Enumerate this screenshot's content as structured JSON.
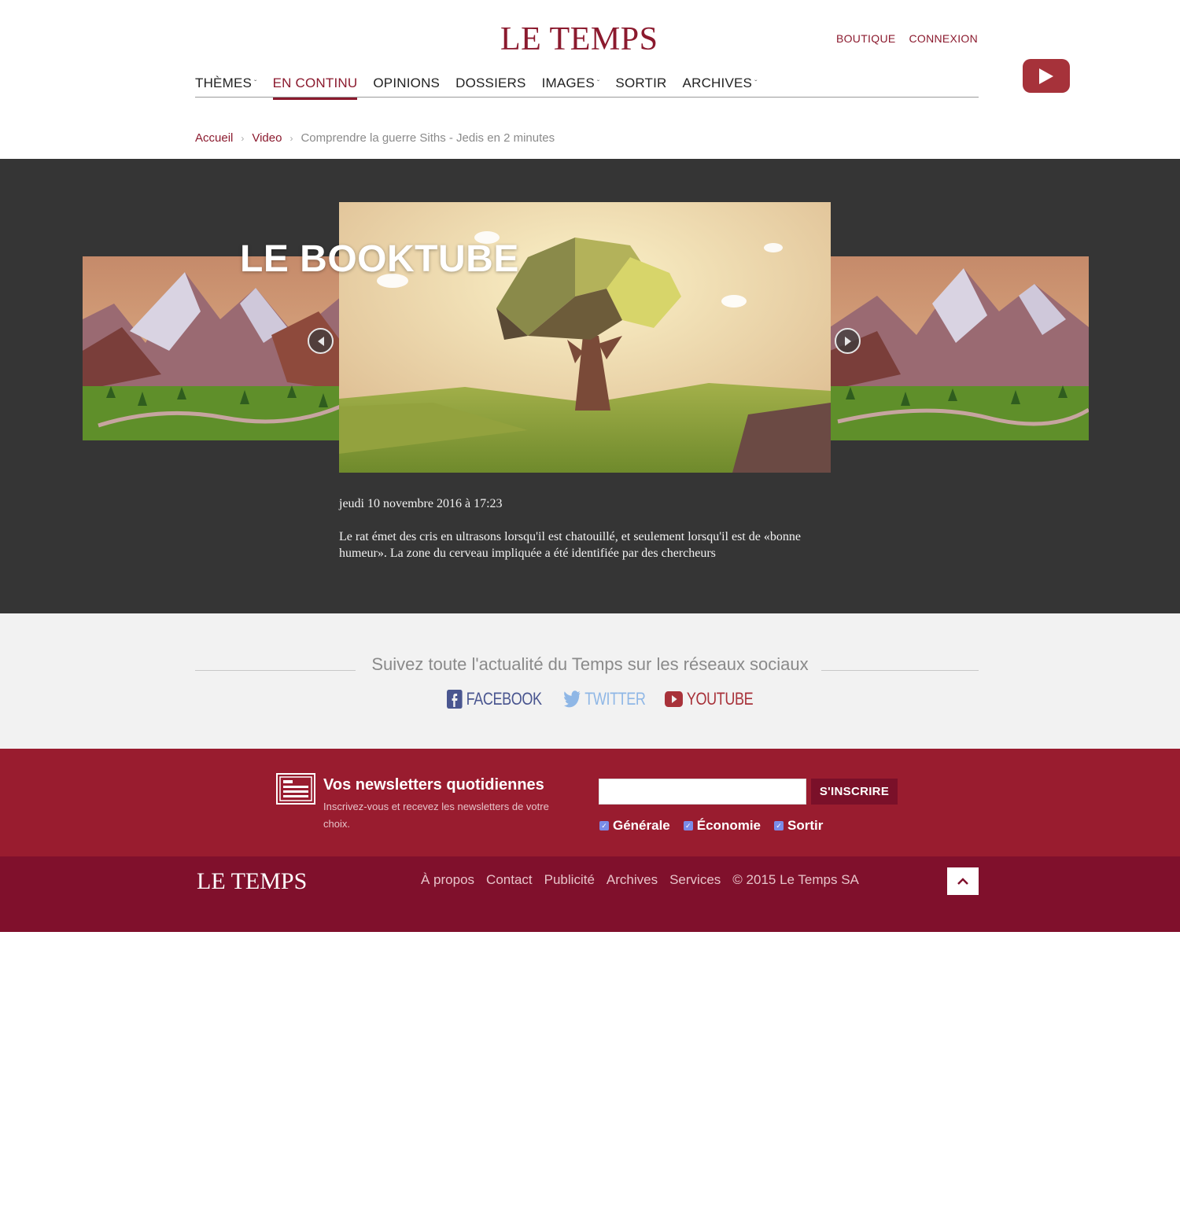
{
  "header": {
    "logo": "LE TEMPS",
    "top_links": [
      "BOUTIQUE",
      "CONNEXION"
    ],
    "youtube_badge_icon": "youtube-play-icon"
  },
  "nav": {
    "items": [
      {
        "label": "THÈMES",
        "has_dropdown": true
      },
      {
        "label": "EN CONTINU",
        "active": true
      },
      {
        "label": "OPINIONS"
      },
      {
        "label": "DOSSIERS"
      },
      {
        "label": "IMAGES",
        "has_dropdown": true
      },
      {
        "label": "SORTIR"
      },
      {
        "label": "ARCHIVES",
        "has_dropdown": true
      }
    ],
    "dropdown_glyph": "ˇ"
  },
  "breadcrumb": {
    "items": [
      "Accueil",
      "Video"
    ],
    "current": "Comprendre la guerre Siths - Jedis en 2 minutes",
    "separator": "›"
  },
  "video": {
    "title": "LE BOOKTUBE",
    "date": "jeudi 10 novembre 2016 à 17:23",
    "description": "Le rat émet des cris en ultrasons lorsqu'il est chatouillé, et seulement lorsqu'il est de «bonne humeur». La zone du cerveau impliquée a été identifiée par des chercheurs"
  },
  "social": {
    "title": "Suivez toute l'actualité du Temps sur les réseaux sociaux",
    "links": [
      {
        "label": "FACEBOOK",
        "icon": "facebook-icon"
      },
      {
        "label": "TWITTER",
        "icon": "twitter-icon"
      },
      {
        "label": "YOUTUBE",
        "icon": "youtube-icon"
      }
    ]
  },
  "newsletter": {
    "title": "Vos newsletters quotidiennes",
    "subtitle": "Inscrivez-vous et recevez les newsletters de votre choix.",
    "input_value": "",
    "button_label": "S'INSCRIRE",
    "options": [
      {
        "label": "Générale",
        "checked": true
      },
      {
        "label": "Économie",
        "checked": true
      },
      {
        "label": "Sortir",
        "checked": true
      }
    ]
  },
  "footer": {
    "logo": "LE TEMPS",
    "links": [
      "À propos",
      "Contact",
      "Publicité",
      "Archives",
      "Services"
    ],
    "copyright": "© 2015 Le Temps SA"
  },
  "colors": {
    "brand": "#8b1a2e",
    "stage_bg": "#353535",
    "newsletter_bg": "#991c2f",
    "footer_bg": "#80102c"
  }
}
